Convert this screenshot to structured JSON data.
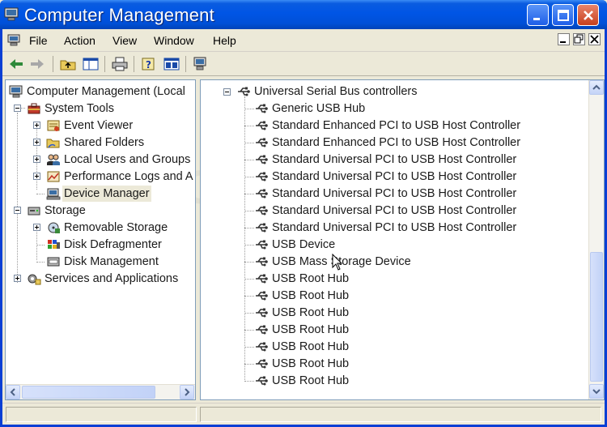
{
  "window": {
    "title": "Computer Management"
  },
  "menubar": {
    "items": [
      "File",
      "Action",
      "View",
      "Window",
      "Help"
    ]
  },
  "toolbar": {
    "icons": [
      "back-arrow-icon",
      "forward-arrow-icon",
      "up-folder-icon",
      "show-hide-tree-icon",
      "print-icon",
      "help-icon",
      "properties-icon",
      "scan-hardware-icon"
    ]
  },
  "tree": {
    "root": "Computer Management (Local",
    "system_tools": "System Tools",
    "event_viewer": "Event Viewer",
    "shared_folders": "Shared Folders",
    "local_users": "Local Users and Groups",
    "performance_logs": "Performance Logs and A",
    "device_manager": "Device Manager",
    "storage": "Storage",
    "removable_storage": "Removable Storage",
    "disk_defragmenter": "Disk Defragmenter",
    "disk_management": "Disk Management",
    "services_apps": "Services and Applications"
  },
  "devices": {
    "category": "Universal Serial Bus controllers",
    "items": [
      "Generic USB Hub",
      "Standard Enhanced PCI to USB Host Controller",
      "Standard Enhanced PCI to USB Host Controller",
      "Standard Universal PCI to USB Host Controller",
      "Standard Universal PCI to USB Host Controller",
      "Standard Universal PCI to USB Host Controller",
      "Standard Universal PCI to USB Host Controller",
      "Standard Universal PCI to USB Host Controller",
      "USB Device",
      "USB Mass Storage Device",
      "USB Root Hub",
      "USB Root Hub",
      "USB Root Hub",
      "USB Root Hub",
      "USB Root Hub",
      "USB Root Hub",
      "USB Root Hub"
    ]
  },
  "colors": {
    "title_blue": "#0055e5",
    "window_bg": "#ece9d8",
    "close_red": "#c7401e"
  }
}
